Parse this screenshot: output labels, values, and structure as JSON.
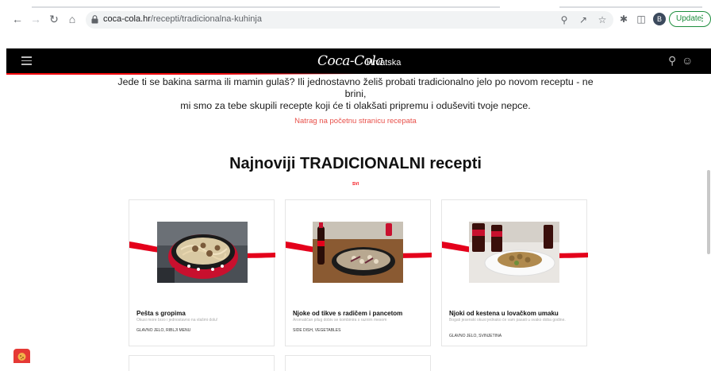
{
  "browser": {
    "url_domain": "coca-cola.hr",
    "url_path": "/recepti/tradicionalna-kuhinja",
    "profile_initial": "B",
    "update_label": "Update"
  },
  "site_header": {
    "logo_text": "Coca-Cola",
    "country": "Hrvatska"
  },
  "intro": {
    "line1": "Jede ti se bakina sarma ili mamin gulaš? Ili jednostavno želiš probati tradicionalno jelo po novom receptu - ne brini,",
    "line2": "mi smo za tebe skupili recepte koji će ti olakšati pripremu i oduševiti tvoje nepce."
  },
  "back_link": "Natrag na početnu stranicu recepata",
  "section": {
    "title": "Najnoviji TRADICIONALNI recepti",
    "all_link": "SVI"
  },
  "cards": [
    {
      "title": "Pešta s gropima",
      "description": "Okusi more brzo i jednostavno na vlašmi dolu!",
      "category": "GLAVNO JELO, RIBLJI MENU"
    },
    {
      "title": "Njoke od tikve s radičem i pancetom",
      "description": "Aromatičan pilug dobiv se kombinira s raznim mesom",
      "category": "SIDE DISH, VEGETABLES"
    },
    {
      "title": "Njoki od kestena u lovačkom umaku",
      "description": "Bogati jesenski okusi jednako će vam pasati u svako doba godine.",
      "category": "GLAVNO JELO, SVINJETINA"
    }
  ],
  "colors": {
    "brand_red": "#f40009",
    "header_bg": "#000000",
    "link_red": "#e8504a"
  }
}
